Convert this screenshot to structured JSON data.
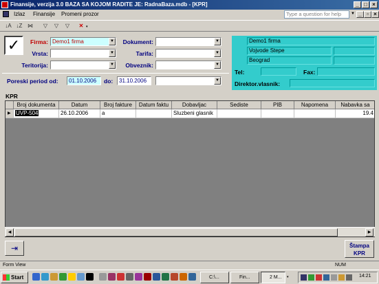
{
  "title_bar": {
    "title": "Finansije, verzija 3.0      BAZA SA KOJOM RADITE JE: RadnaBaza.mdb - [KPR]"
  },
  "menu": {
    "items": [
      "Izlaz",
      "Finansije",
      "Promeni prozor"
    ],
    "help_placeholder": "Type a question for help"
  },
  "form": {
    "firma_label": "Firma:",
    "firma_value": "Demo1 firma",
    "vrsta_label": "Vrsta:",
    "vrsta_value": "",
    "teritorija_label": "Teritorija:",
    "teritorija_value": "",
    "dokument_label": "Dokument:",
    "dokument_value": "",
    "tarifa_label": "Tarifa:",
    "tarifa_value": "",
    "obveznik_label": "Obveznik:",
    "obveznik_value": "",
    "period_label": "Poreski period od:",
    "period_from": "01.10.2006",
    "period_to_label": "do:",
    "period_to": "31.10.2006",
    "period_extra": ""
  },
  "company": {
    "name": "Demo1 firma",
    "address": "Vojvode Stepe",
    "city": "Beograd",
    "tel_label": "Tel:",
    "fax_label": "Fax:",
    "director_label": "Direktor.vlasnik:"
  },
  "kpr": {
    "label": "KPR",
    "columns": [
      "Broj dokumenta",
      "Datum",
      "Broj fakture",
      "Datum faktu",
      "Dobavljac",
      "Sediste",
      "PIB",
      "Napomena",
      "Nabavka sa"
    ],
    "rows": [
      [
        "UVP-504",
        "26.10.2006",
        "a",
        "",
        "Sluzbeni glasnik",
        "",
        "",
        "",
        "19.4"
      ]
    ]
  },
  "buttons": {
    "stampa_line1": "Štampa",
    "stampa_line2": "KPR"
  },
  "status": {
    "left": "Form View",
    "right": "NUM"
  },
  "taskbar": {
    "start": "Start",
    "tasks": [
      "C:\\...",
      "Fin...",
      "2 M..."
    ],
    "clock": "14:21"
  }
}
